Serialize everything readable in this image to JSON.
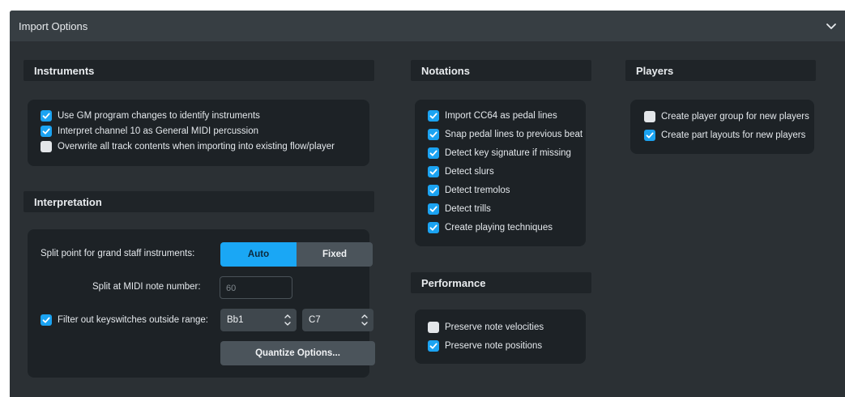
{
  "titlebar": {
    "title": "Import Options",
    "collapse_icon": "chevron-down-icon"
  },
  "instruments": {
    "header": "Instruments",
    "options": [
      {
        "label": "Use GM program changes to identify instruments",
        "checked": true
      },
      {
        "label": "Interpret channel 10 as General MIDI percussion",
        "checked": true
      },
      {
        "label": "Overwrite all track contents when importing into existing flow/player",
        "checked": false
      }
    ]
  },
  "interpretation": {
    "header": "Interpretation",
    "split_point_label": "Split point for grand staff instruments:",
    "split_modes": {
      "auto": "Auto",
      "fixed": "Fixed",
      "selected": "Auto"
    },
    "split_note_label": "Split at MIDI note number:",
    "split_note_value": "60",
    "filter_label": "Filter out keyswitches outside range:",
    "filter_checked": true,
    "range_low": "Bb1",
    "range_high": "C7",
    "quantize_button": "Quantize Options..."
  },
  "notations": {
    "header": "Notations",
    "options": [
      {
        "label": "Import CC64 as pedal lines",
        "checked": true
      },
      {
        "label": "Snap pedal lines to previous beat",
        "checked": true
      },
      {
        "label": "Detect key signature if missing",
        "checked": true
      },
      {
        "label": "Detect slurs",
        "checked": true
      },
      {
        "label": "Detect tremolos",
        "checked": true
      },
      {
        "label": "Detect trills",
        "checked": true
      },
      {
        "label": "Create playing techniques",
        "checked": true
      }
    ]
  },
  "performance": {
    "header": "Performance",
    "options": [
      {
        "label": "Preserve note velocities",
        "checked": false
      },
      {
        "label": "Preserve note positions",
        "checked": true
      }
    ]
  },
  "players": {
    "header": "Players",
    "options": [
      {
        "label": "Create player group for new players",
        "checked": false
      },
      {
        "label": "Create part layouts for new players",
        "checked": true
      }
    ]
  },
  "colors": {
    "accent": "#1ba3f2",
    "background": "#2b3034",
    "panel": "#1d2226"
  }
}
